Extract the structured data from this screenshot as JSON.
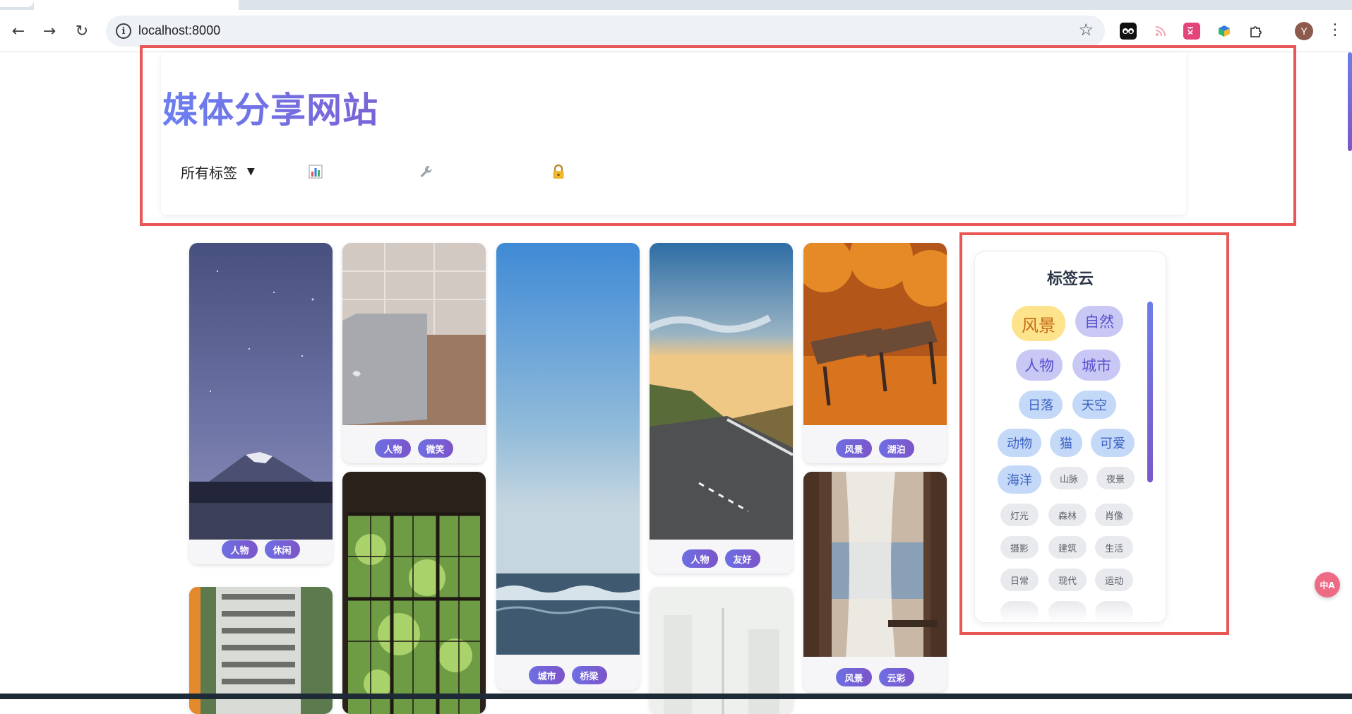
{
  "browser": {
    "url": "localhost:8000",
    "avatar_initial": "Y",
    "nav": {
      "back": "back-icon",
      "forward": "forward-icon",
      "reload": "reload-icon"
    }
  },
  "header": {
    "title": "媒体分享网站",
    "tag_filter": {
      "selected": "所有标签"
    },
    "icons": [
      "chart-icon",
      "wrench-icon",
      "lock-icon"
    ]
  },
  "gallery": {
    "cards": [
      {
        "tags": [
          "人物",
          "休闲"
        ]
      },
      {
        "tags": []
      },
      {
        "tags": [
          "人物",
          "微笑"
        ]
      },
      {
        "tags": []
      },
      {
        "tags": [
          "城市",
          "桥梁"
        ]
      },
      {
        "tags": [
          "人物",
          "友好"
        ]
      },
      {
        "tags": []
      },
      {
        "tags": [
          "风景",
          "湖泊"
        ]
      },
      {
        "tags": [
          "风景",
          "云彩"
        ]
      }
    ]
  },
  "tag_cloud": {
    "title": "标签云",
    "tags": [
      "风景",
      "自然",
      "人物",
      "城市",
      "日落",
      "天空",
      "动物",
      "猫",
      "可爱",
      "海洋",
      "山脉",
      "夜景",
      "灯光",
      "森林",
      "肖像",
      "摄影",
      "建筑",
      "生活",
      "日常",
      "现代",
      "运动"
    ]
  },
  "colors": {
    "accent": "#6b7ff0",
    "annotation": "#e85655",
    "pill_gradient_start": "#6d6fe3",
    "pill_gradient_end": "#7c55c9"
  }
}
